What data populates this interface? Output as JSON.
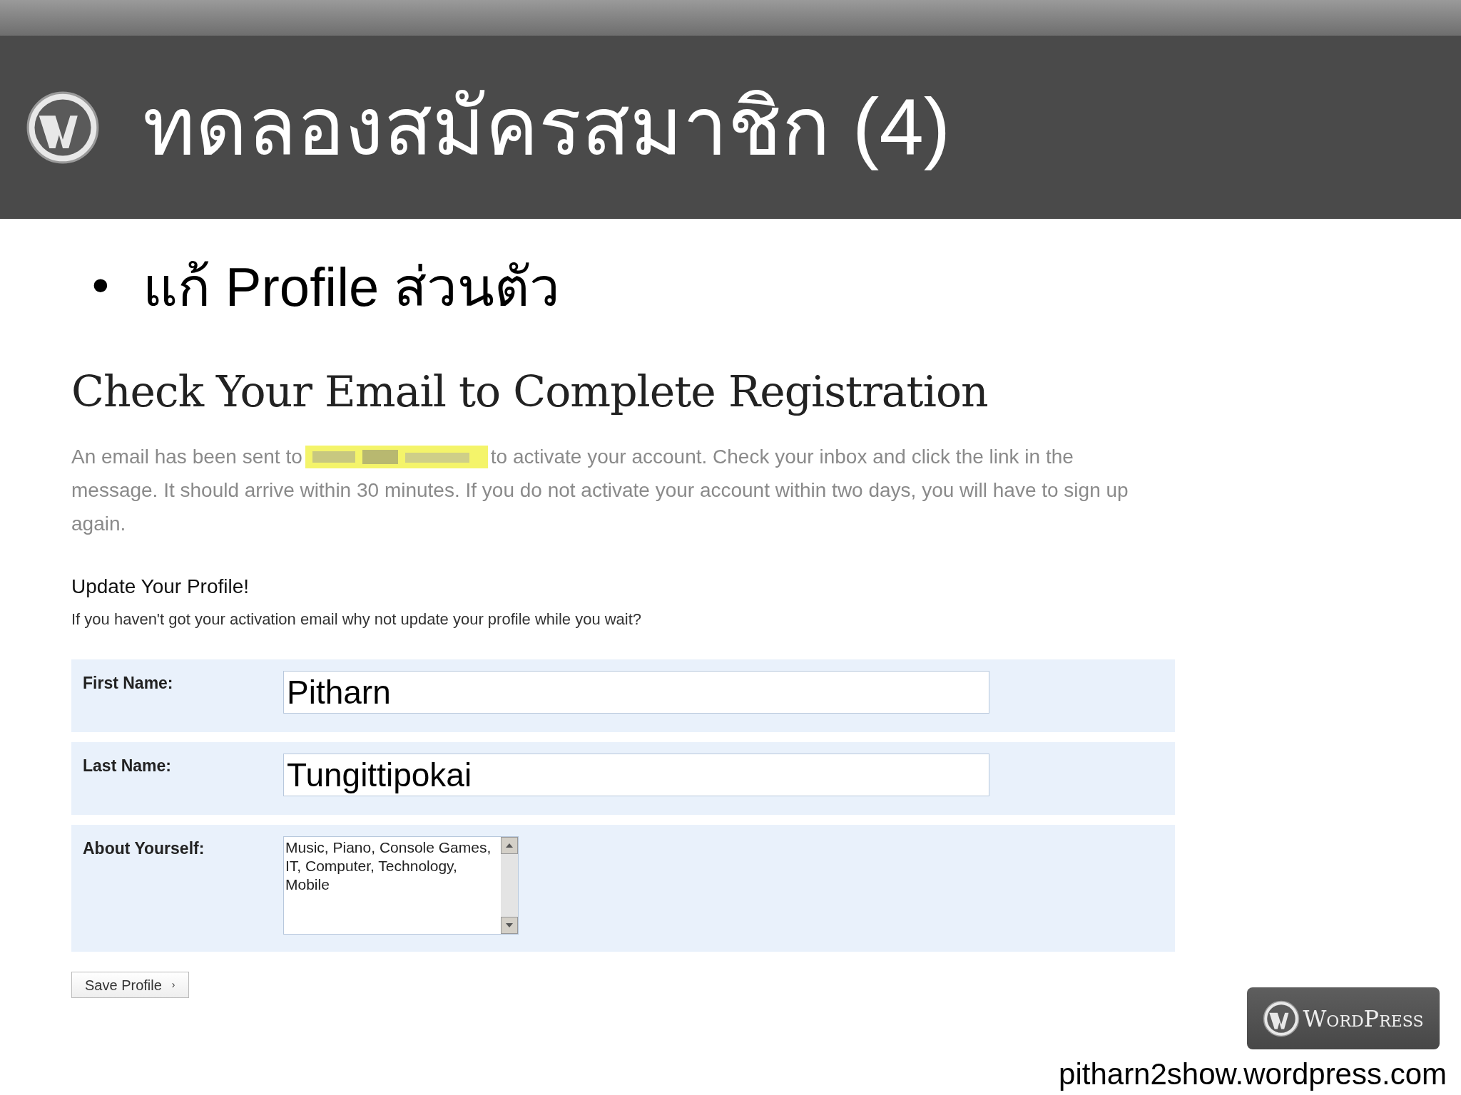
{
  "slide": {
    "title": "ทดลองสมัครสมาชิก (4)",
    "bullet": "•",
    "bullet_text": "แก้ Profile ส่วนตัว"
  },
  "page": {
    "heading": "Check Your Email to Complete Registration",
    "message_before": "An email has been sent to",
    "message_after": "to activate your account. Check your inbox and click the link in the",
    "message_lines": [
      "message. It should arrive within 30 minutes. If you do not activate your account within two days, you will have to sign up",
      "again."
    ],
    "subheading": "Update Your Profile!",
    "subtext": "If you haven't got your activation email why not update your profile while you wait?",
    "fields": [
      {
        "kind": "input",
        "label": "First Name:",
        "value": "Pitharn"
      },
      {
        "kind": "input",
        "label": "Last Name:",
        "value": "Tungittipokai"
      },
      {
        "kind": "textarea",
        "label": "About Yourself:",
        "value": "Music, Piano, Console Games, IT, Computer, Technology, Mobile"
      }
    ],
    "save_button": {
      "label": "Save Profile",
      "caret": "›"
    }
  },
  "footer": {
    "logo_text": "WordPress",
    "url": "pitharn2show.wordpress.com"
  }
}
